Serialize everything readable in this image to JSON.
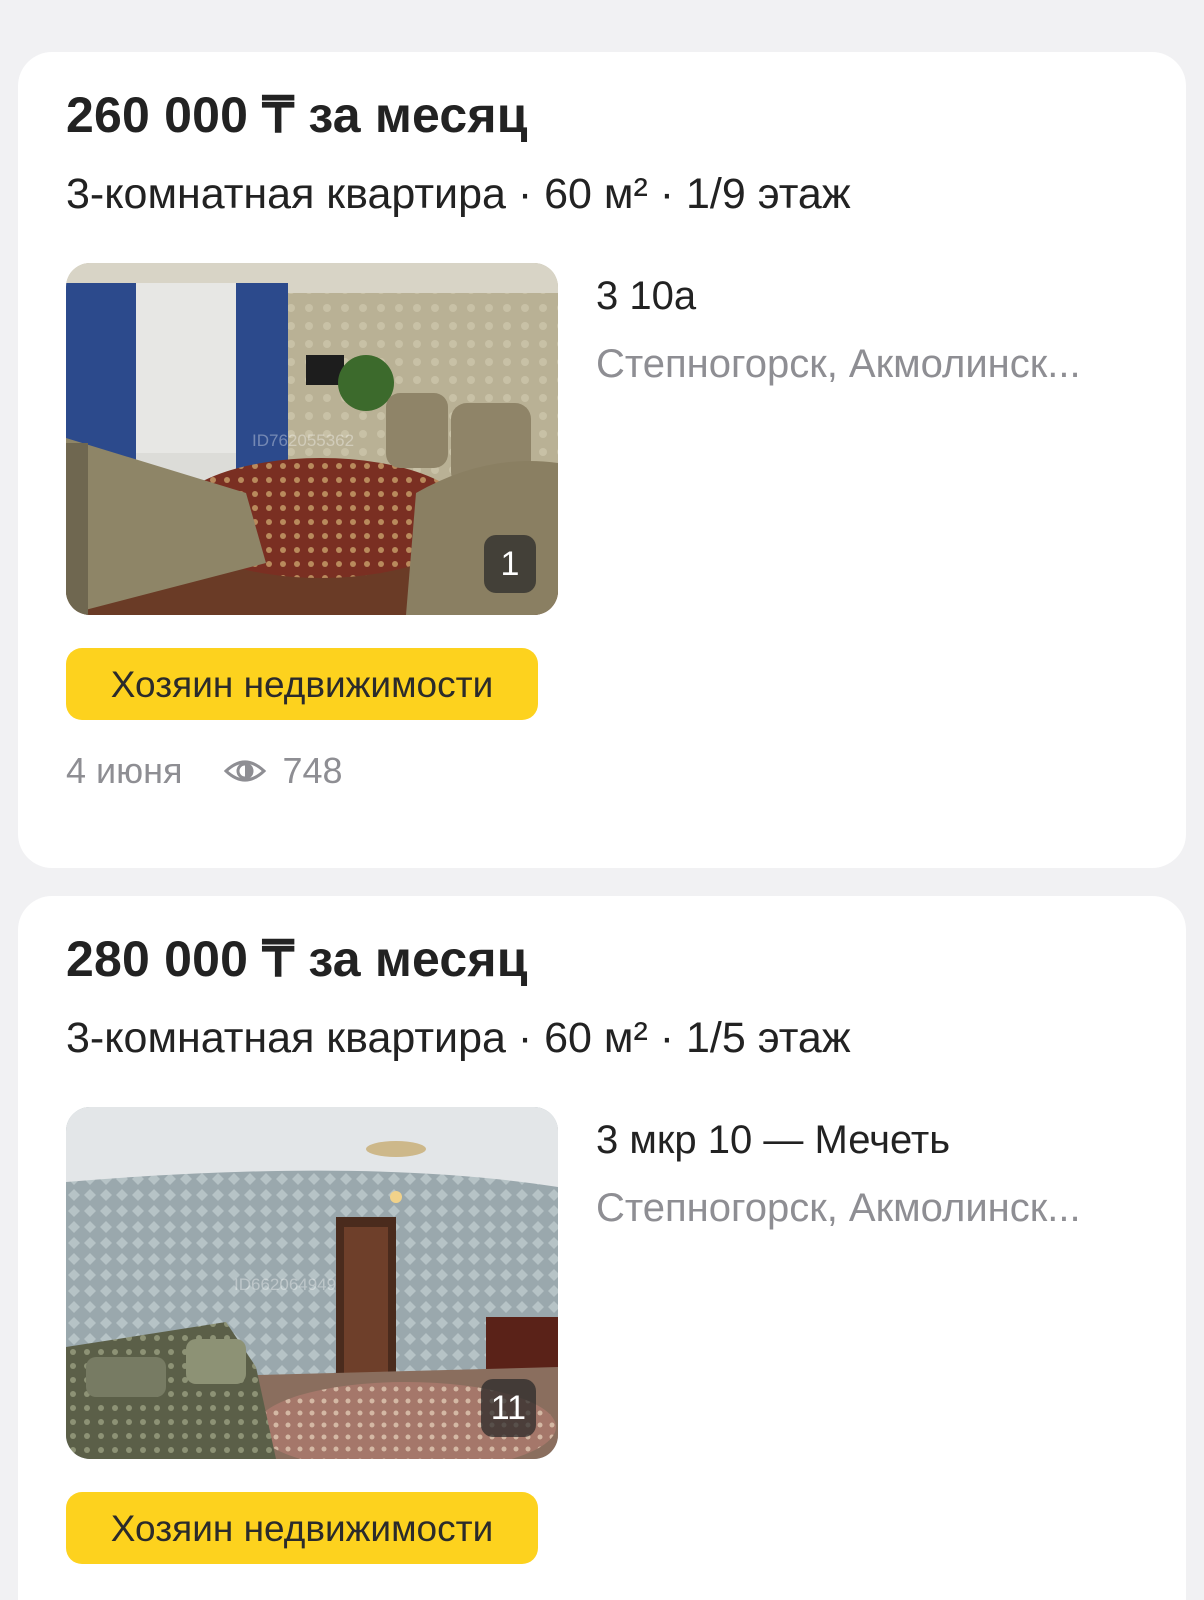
{
  "listings": [
    {
      "price": "260 000 ₸ за месяц",
      "subtitle": "3-комнатная квартира · 60 м² · 1/9 этаж",
      "address": "3 10а",
      "city": "Степногорск, Акмолинск...",
      "photo_count": "1",
      "photo_watermark": "ID762055362",
      "owner_badge": "Хозяин недвижимости",
      "date": "4 июня",
      "views": "748"
    },
    {
      "price": "280 000 ₸ за месяц",
      "subtitle": "3-комнатная квартира · 60 м² · 1/5 этаж",
      "address": "3 мкр 10 — Мечеть",
      "city": "Степногорск, Акмолинск...",
      "photo_count": "11",
      "photo_watermark": "ID662064949",
      "owner_badge": "Хозяин недвижимости"
    }
  ],
  "colors": {
    "background": "#f1f1f3",
    "card": "#ffffff",
    "owner_badge": "#fdd21e",
    "secondary_text": "#8e8e93"
  },
  "icons": {
    "views": "eye-icon"
  }
}
